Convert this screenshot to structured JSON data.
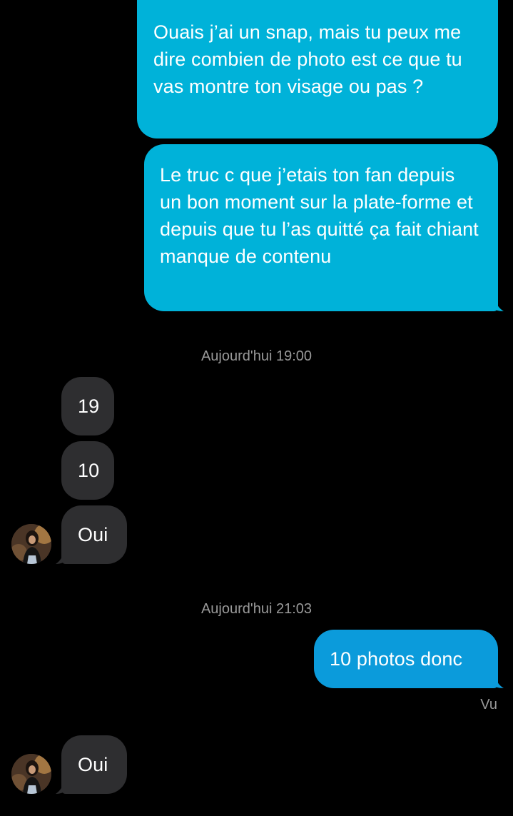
{
  "messages": [
    {
      "from": "me",
      "text": "Ouais j’ai un snap,  mais tu peux me dire combien de photo est ce que tu vas montre ton visage ou pas ?"
    },
    {
      "from": "me",
      "text": "Le truc c que j’etais ton fan depuis un bon moment sur la plate-forme et depuis que tu l’as quitté ça fait chiant manque de contenu"
    },
    {
      "type": "timestamp",
      "text": "Aujourd'hui 19:00"
    },
    {
      "from": "them",
      "text": "19"
    },
    {
      "from": "them",
      "text": "10"
    },
    {
      "from": "them",
      "text": "Oui"
    },
    {
      "type": "timestamp",
      "text": "Aujourd'hui 21:03"
    },
    {
      "from": "me",
      "text": "10 photos donc"
    },
    {
      "type": "status",
      "text": "Vu"
    },
    {
      "from": "them",
      "text": "Oui"
    }
  ],
  "avatar_icon": "profile-photo",
  "colors": {
    "sent_bubble": "#00B2D9",
    "received_bubble": "#2E2E30",
    "background": "#000000",
    "meta_text": "#9a9a9a"
  }
}
